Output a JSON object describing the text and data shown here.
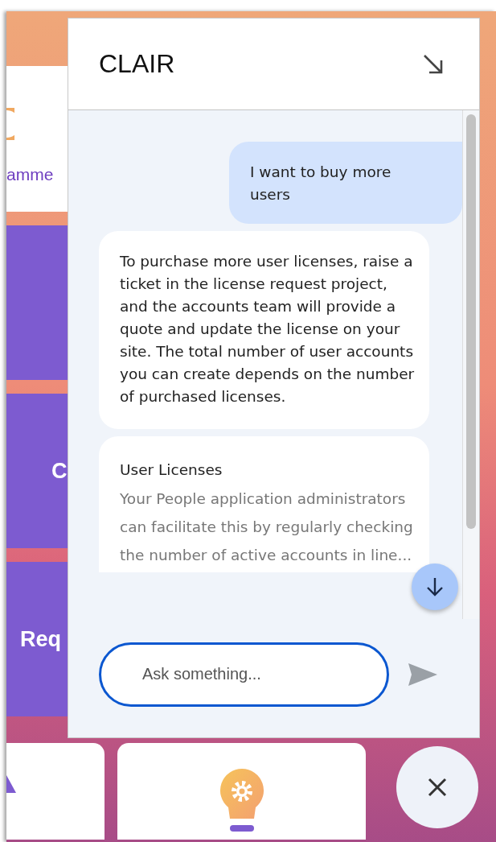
{
  "background": {
    "tiles": [
      {
        "kind": "card",
        "label": "amme"
      },
      {
        "kind": "tile"
      },
      {
        "kind": "tile",
        "label": "C"
      },
      {
        "kind": "tile",
        "label": "Req"
      }
    ]
  },
  "chat": {
    "title": "CLAIR",
    "messages": [
      {
        "kind": "user",
        "text": "I want to buy more users"
      },
      {
        "kind": "bot",
        "text": "To purchase more user licenses, raise a ticket in the license request project, and the accounts team will provide a quote and update the license on your site. The total number of user accounts you can create depends on the number of purchased licenses."
      },
      {
        "kind": "source",
        "title": "User Licenses",
        "text": "Your People application administrators can facilitate this by regularly checking the number of active accounts in line..."
      }
    ],
    "input": {
      "placeholder": "Ask something..."
    }
  }
}
